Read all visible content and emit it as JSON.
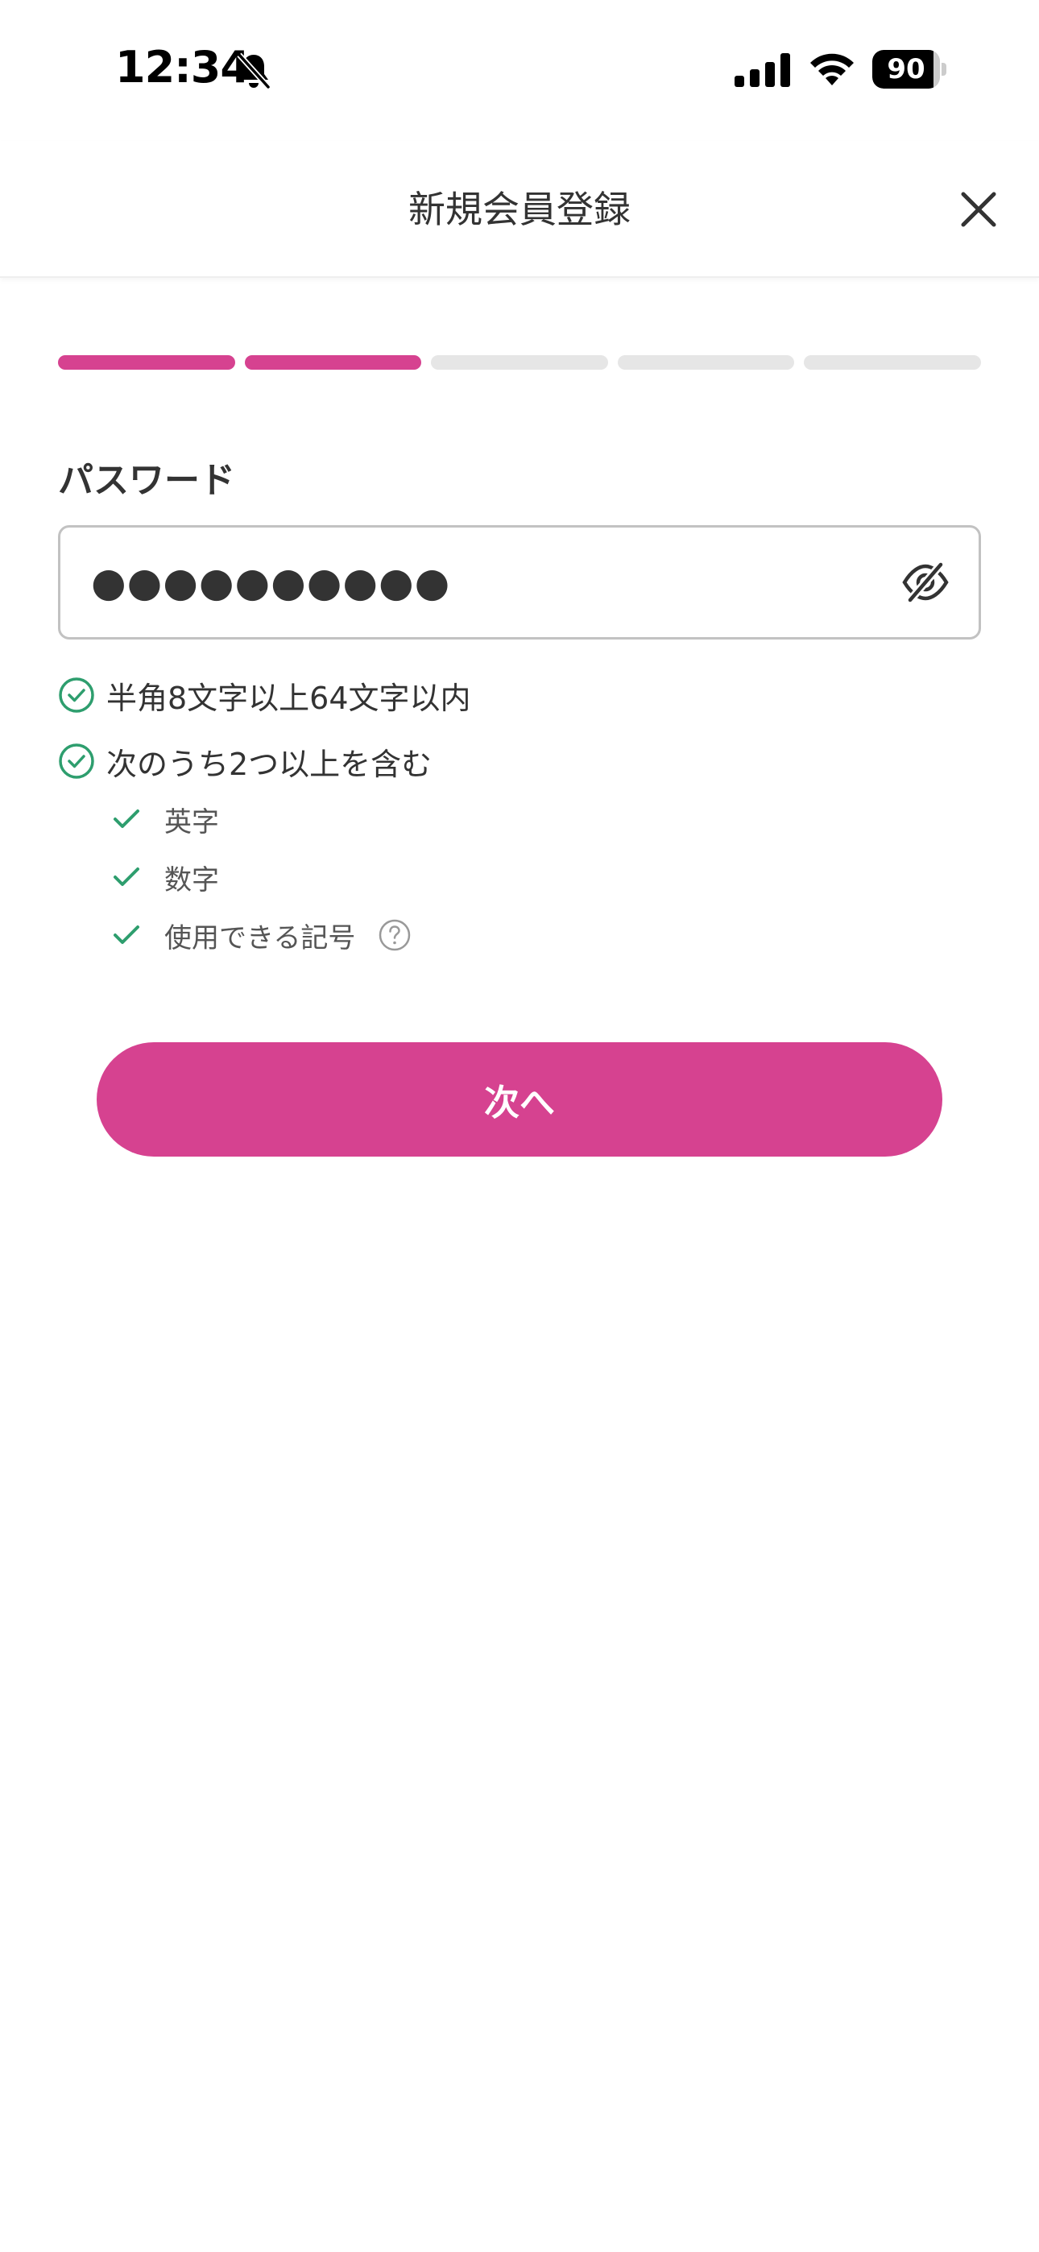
{
  "status_bar": {
    "time": "12:34",
    "battery": "90",
    "battery_level": 0.9
  },
  "header": {
    "title": "新規会員登録"
  },
  "progress": {
    "total_steps": 5,
    "current_step": 2
  },
  "password": {
    "label": "パスワード",
    "masked_value": "●●●●●●●●●●"
  },
  "rules": {
    "length": "半角8文字以上64文字以内",
    "contains": "次のうち2つ以上を含む",
    "sub": {
      "letters": "英字",
      "numbers": "数字",
      "symbols": "使用できる記号"
    }
  },
  "next_button": {
    "label": "次へ"
  },
  "colors": {
    "accent": "#d64290",
    "check_green": "#2e9e6e",
    "progress_inactive": "#e6e6e6"
  },
  "icons": {
    "bell": "bell-slash-icon",
    "signal": "cellular-signal-icon",
    "wifi": "wifi-icon",
    "close": "close-icon",
    "eye": "eye-off-icon",
    "rule_check": "circle-check-icon",
    "sub_check": "check-icon",
    "help": "question-circle-icon"
  }
}
